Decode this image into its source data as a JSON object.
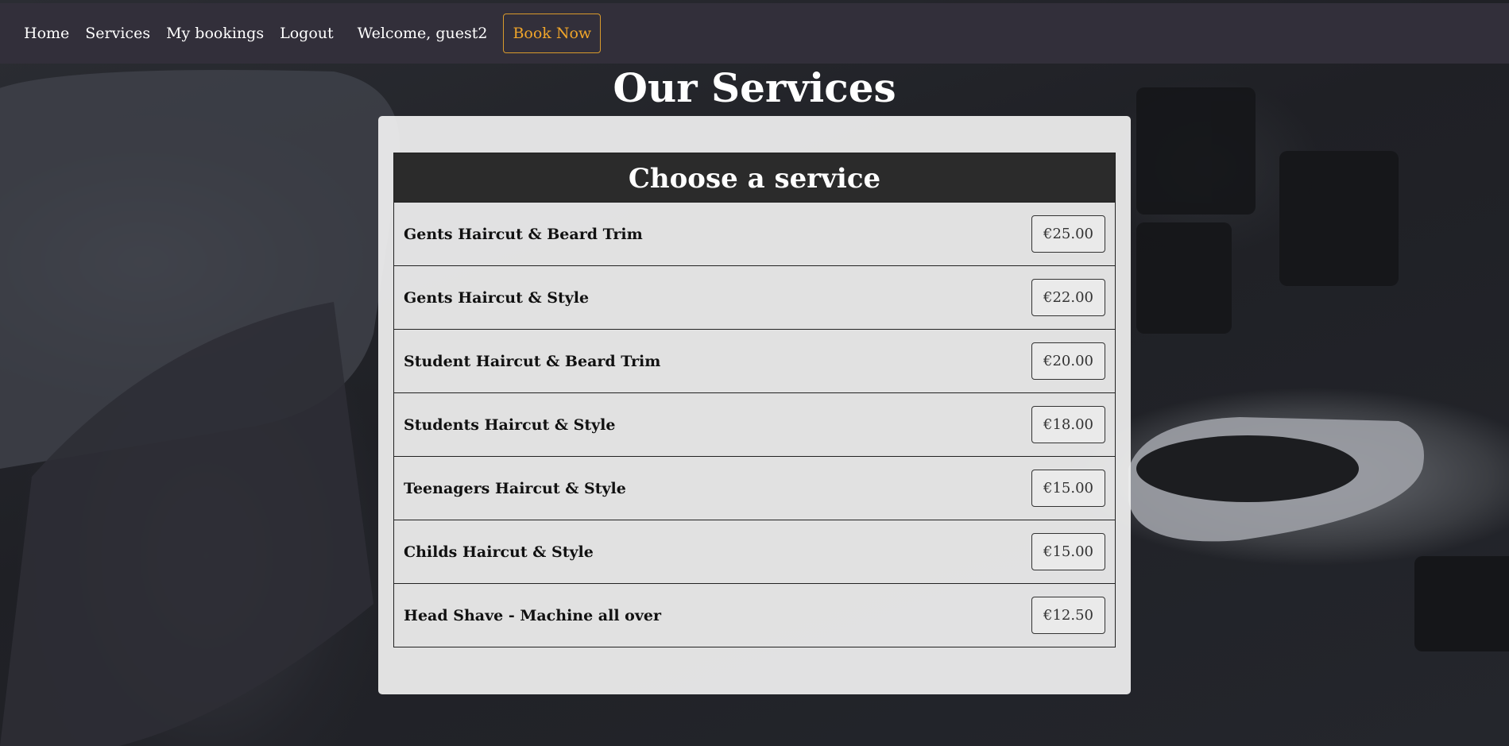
{
  "nav": {
    "home": "Home",
    "services": "Services",
    "bookings": "My bookings",
    "logout": "Logout",
    "welcome": "Welcome, guest2",
    "book_now": "Book Now"
  },
  "page": {
    "title": "Our Services"
  },
  "table": {
    "header": "Choose a service",
    "rows": [
      {
        "name": "Gents Haircut & Beard Trim",
        "price": "€25.00"
      },
      {
        "name": "Gents Haircut & Style",
        "price": "€22.00"
      },
      {
        "name": "Student Haircut & Beard Trim",
        "price": "€20.00"
      },
      {
        "name": "Students Haircut & Style",
        "price": "€18.00"
      },
      {
        "name": "Teenagers Haircut & Style",
        "price": "€15.00"
      },
      {
        "name": "Childs Haircut & Style",
        "price": "€15.00"
      },
      {
        "name": "Head Shave - Machine all over",
        "price": "€12.50"
      }
    ]
  },
  "colors": {
    "navbar": "#322f3a",
    "book_now_accent": "#f0a52a",
    "table_header": "#2b2b2b"
  }
}
